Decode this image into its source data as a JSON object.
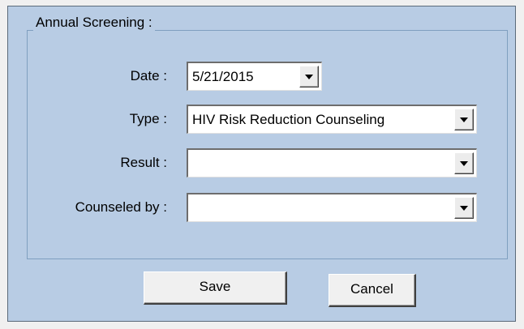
{
  "group": {
    "legend": "Annual Screening :"
  },
  "fields": {
    "date": {
      "label": "Date :",
      "value": "5/21/2015"
    },
    "type": {
      "label": "Type :",
      "value": "HIV Risk Reduction Counseling"
    },
    "result": {
      "label": "Result :",
      "value": ""
    },
    "counseled_by": {
      "label": "Counseled by :",
      "value": ""
    }
  },
  "buttons": {
    "save": "Save",
    "cancel": "Cancel"
  },
  "colors": {
    "dialog_background": "#b8cce4",
    "field_background": "#ffffff"
  },
  "icons": {
    "dropdown": "chevron-down-icon"
  }
}
